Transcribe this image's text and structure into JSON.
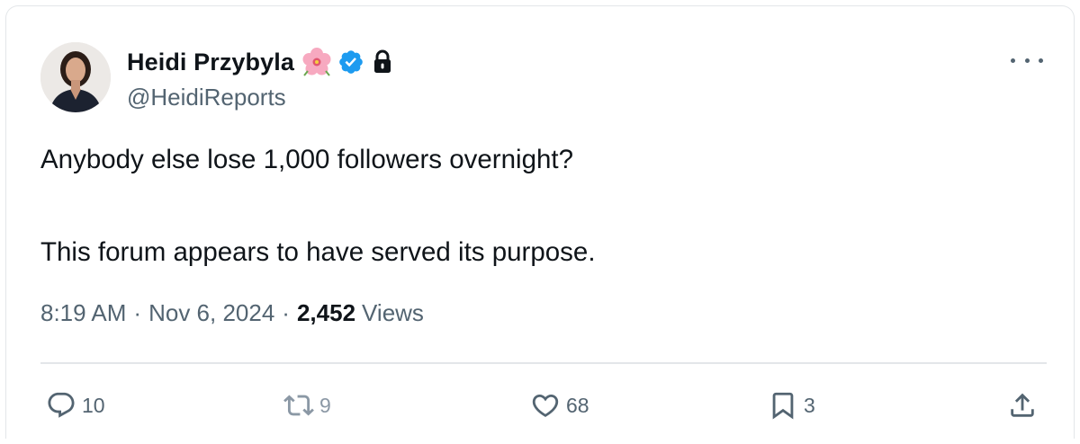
{
  "user": {
    "display_name": "Heidi Przybyla",
    "handle": "@HeidiReports",
    "badges": [
      "flower-emoji-icon",
      "verified-badge-icon",
      "lock-icon"
    ]
  },
  "tweet": {
    "lines": [
      "Anybody else lose 1,000 followers overnight?",
      "This forum appears to have served its purpose."
    ],
    "time": "8:19 AM",
    "date": "Nov 6, 2024",
    "separator": "·",
    "views_count": "2,452",
    "views_label": "Views"
  },
  "actions": {
    "reply_count": "10",
    "retweet_count": "9",
    "like_count": "68",
    "bookmark_count": "3"
  },
  "colors": {
    "text": "#0f1419",
    "secondary": "#536471",
    "verified": "#1d9bf0",
    "border": "#e3e6e9"
  }
}
